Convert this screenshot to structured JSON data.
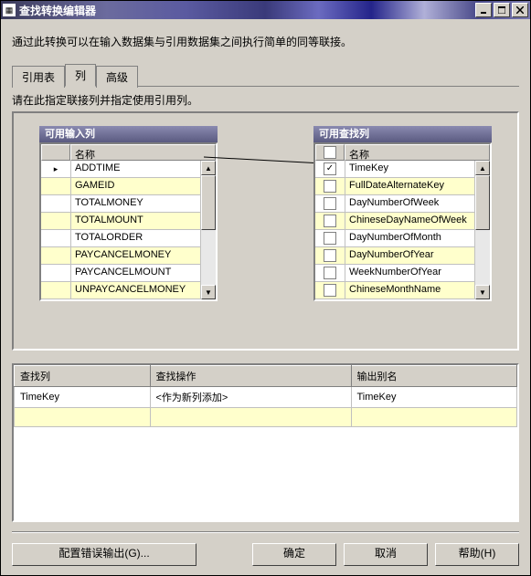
{
  "window": {
    "title": "查找转换编辑器",
    "description": "通过此转换可以在输入数据集与引用数据集之间执行简单的同等联接。"
  },
  "tabs": {
    "items": [
      "引用表",
      "列",
      "高级"
    ],
    "active_index": 1,
    "subdesc": "请在此指定联接列并指定使用引用列。"
  },
  "input_list": {
    "title": "可用输入列",
    "header": "名称",
    "rows": [
      {
        "label": "ADDTIME",
        "connected": true
      },
      {
        "label": "GAMEID"
      },
      {
        "label": "TOTALMONEY"
      },
      {
        "label": "TOTALMOUNT"
      },
      {
        "label": "TOTALORDER"
      },
      {
        "label": "PAYCANCELMONEY"
      },
      {
        "label": "PAYCANCELMOUNT"
      },
      {
        "label": "UNPAYCANCELMONEY"
      }
    ]
  },
  "lookup_list": {
    "title": "可用查找列",
    "header": "名称",
    "check_all": false,
    "rows": [
      {
        "label": "TimeKey",
        "checked": true
      },
      {
        "label": "FullDateAlternateKey",
        "checked": false
      },
      {
        "label": "DayNumberOfWeek",
        "checked": false
      },
      {
        "label": "ChineseDayNameOfWeek",
        "checked": false
      },
      {
        "label": "DayNumberOfMonth",
        "checked": false
      },
      {
        "label": "DayNumberOfYear",
        "checked": false
      },
      {
        "label": "WeekNumberOfYear",
        "checked": false
      },
      {
        "label": "ChineseMonthName",
        "checked": false
      }
    ]
  },
  "mapping_table": {
    "headers": [
      "查找列",
      "查找操作",
      "输出别名"
    ],
    "rows": [
      {
        "col": "TimeKey",
        "op": "<作为新列添加>",
        "alias": "TimeKey"
      }
    ]
  },
  "buttons": {
    "configure_error": "配置错误输出(G)...",
    "ok": "确定",
    "cancel": "取消",
    "help": "帮助(H)"
  }
}
